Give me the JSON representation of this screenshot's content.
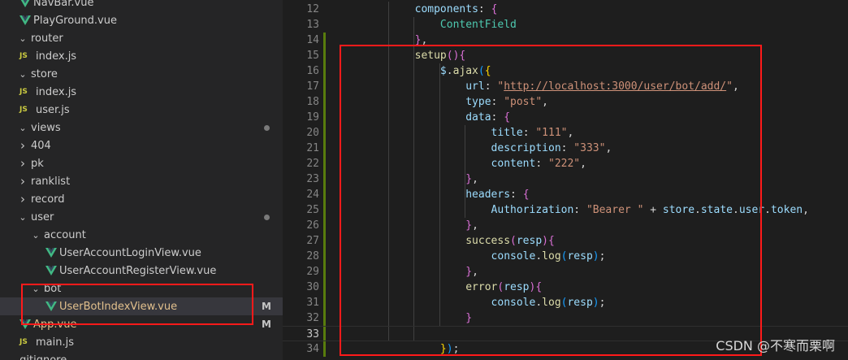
{
  "explorer": {
    "items": [
      {
        "label": "NavBar.vue",
        "type": "vue",
        "indent": 2
      },
      {
        "label": "PlayGround.vue",
        "type": "vue",
        "indent": 2
      },
      {
        "label": "router",
        "type": "folder-open",
        "indent": 1
      },
      {
        "label": "index.js",
        "type": "js",
        "indent": 2
      },
      {
        "label": "store",
        "type": "folder-open",
        "indent": 1
      },
      {
        "label": "index.js",
        "type": "js",
        "indent": 2
      },
      {
        "label": "user.js",
        "type": "js",
        "indent": 2
      },
      {
        "label": "views",
        "type": "folder-open",
        "indent": 1,
        "dot": true
      },
      {
        "label": "404",
        "type": "folder-closed",
        "indent": 2
      },
      {
        "label": "pk",
        "type": "folder-closed",
        "indent": 2
      },
      {
        "label": "ranklist",
        "type": "folder-closed",
        "indent": 2
      },
      {
        "label": "record",
        "type": "folder-closed",
        "indent": 2
      },
      {
        "label": "user",
        "type": "folder-open",
        "indent": 2,
        "dot": true
      },
      {
        "label": "account",
        "type": "folder-open",
        "indent": 3
      },
      {
        "label": "UserAccountLoginView.vue",
        "type": "vue",
        "indent": 4
      },
      {
        "label": "UserAccountRegisterView.vue",
        "type": "vue",
        "indent": 4
      },
      {
        "label": "bot",
        "type": "folder-open",
        "indent": 3
      },
      {
        "label": "UserBotIndexView.vue",
        "type": "vue",
        "indent": 4,
        "badge": "M",
        "selected": true,
        "modified": true
      },
      {
        "label": "App.vue",
        "type": "vue",
        "indent": 1,
        "badge": "M",
        "modified": true
      },
      {
        "label": "main.js",
        "type": "js",
        "indent": 1
      },
      {
        "label": ".gitignore",
        "type": "file",
        "indent": 0
      }
    ]
  },
  "editor": {
    "active_line": 33,
    "lines": [
      {
        "n": 12,
        "indent": 2,
        "tokens": [
          [
            "prop",
            "components"
          ],
          [
            "plain",
            ": "
          ],
          [
            "brace",
            "{"
          ]
        ]
      },
      {
        "n": 13,
        "indent": 3,
        "tokens": [
          [
            "cls",
            "ContentField"
          ]
        ]
      },
      {
        "n": 14,
        "indent": 2,
        "tokens": [
          [
            "brace",
            "}"
          ],
          [
            "plain",
            ","
          ]
        ]
      },
      {
        "n": 15,
        "indent": 2,
        "tokens": [
          [
            "fn",
            "setup"
          ],
          [
            "brace",
            "()"
          ],
          [
            "brace",
            "{"
          ]
        ]
      },
      {
        "n": 16,
        "indent": 3,
        "tokens": [
          [
            "prop",
            "$"
          ],
          [
            "plain",
            "."
          ],
          [
            "fn",
            "ajax"
          ],
          [
            "brace2",
            "("
          ],
          [
            "paren",
            "{"
          ]
        ]
      },
      {
        "n": 17,
        "indent": 4,
        "tokens": [
          [
            "prop",
            "url"
          ],
          [
            "plain",
            ": "
          ],
          [
            "str",
            "\""
          ],
          [
            "url",
            "http://localhost:3000/user/bot/add/"
          ],
          [
            "str",
            "\""
          ],
          [
            "plain",
            ","
          ]
        ]
      },
      {
        "n": 18,
        "indent": 4,
        "tokens": [
          [
            "prop",
            "type"
          ],
          [
            "plain",
            ": "
          ],
          [
            "str",
            "\"post\""
          ],
          [
            "plain",
            ","
          ]
        ]
      },
      {
        "n": 19,
        "indent": 4,
        "tokens": [
          [
            "prop",
            "data"
          ],
          [
            "plain",
            ": "
          ],
          [
            "brace",
            "{"
          ]
        ]
      },
      {
        "n": 20,
        "indent": 5,
        "tokens": [
          [
            "prop",
            "title"
          ],
          [
            "plain",
            ": "
          ],
          [
            "str",
            "\"111\""
          ],
          [
            "plain",
            ","
          ]
        ]
      },
      {
        "n": 21,
        "indent": 5,
        "tokens": [
          [
            "prop",
            "description"
          ],
          [
            "plain",
            ": "
          ],
          [
            "str",
            "\"333\""
          ],
          [
            "plain",
            ","
          ]
        ]
      },
      {
        "n": 22,
        "indent": 5,
        "tokens": [
          [
            "prop",
            "content"
          ],
          [
            "plain",
            ": "
          ],
          [
            "str",
            "\"222\""
          ],
          [
            "plain",
            ","
          ]
        ]
      },
      {
        "n": 23,
        "indent": 4,
        "tokens": [
          [
            "brace",
            "}"
          ],
          [
            "plain",
            ","
          ]
        ]
      },
      {
        "n": 24,
        "indent": 4,
        "tokens": [
          [
            "prop",
            "headers"
          ],
          [
            "plain",
            ": "
          ],
          [
            "brace",
            "{"
          ]
        ]
      },
      {
        "n": 25,
        "indent": 5,
        "tokens": [
          [
            "prop",
            "Authorization"
          ],
          [
            "plain",
            ": "
          ],
          [
            "str",
            "\"Bearer \""
          ],
          [
            "plain",
            " + "
          ],
          [
            "prop",
            "store"
          ],
          [
            "plain",
            "."
          ],
          [
            "prop",
            "state"
          ],
          [
            "plain",
            "."
          ],
          [
            "prop",
            "user"
          ],
          [
            "plain",
            "."
          ],
          [
            "prop",
            "token"
          ],
          [
            "plain",
            ","
          ]
        ]
      },
      {
        "n": 26,
        "indent": 4,
        "tokens": [
          [
            "brace",
            "}"
          ],
          [
            "plain",
            ","
          ]
        ]
      },
      {
        "n": 27,
        "indent": 4,
        "tokens": [
          [
            "fn",
            "success"
          ],
          [
            "brace",
            "("
          ],
          [
            "prop",
            "resp"
          ],
          [
            "brace",
            ")"
          ],
          [
            "brace",
            "{"
          ]
        ]
      },
      {
        "n": 28,
        "indent": 5,
        "tokens": [
          [
            "prop",
            "console"
          ],
          [
            "plain",
            "."
          ],
          [
            "fn",
            "log"
          ],
          [
            "brace2",
            "("
          ],
          [
            "prop",
            "resp"
          ],
          [
            "brace2",
            ")"
          ],
          [
            "plain",
            ";"
          ]
        ]
      },
      {
        "n": 29,
        "indent": 4,
        "tokens": [
          [
            "brace",
            "}"
          ],
          [
            "plain",
            ","
          ]
        ]
      },
      {
        "n": 30,
        "indent": 4,
        "tokens": [
          [
            "fn",
            "error"
          ],
          [
            "brace",
            "("
          ],
          [
            "prop",
            "resp"
          ],
          [
            "brace",
            ")"
          ],
          [
            "brace",
            "{"
          ]
        ]
      },
      {
        "n": 31,
        "indent": 5,
        "tokens": [
          [
            "prop",
            "console"
          ],
          [
            "plain",
            "."
          ],
          [
            "fn",
            "log"
          ],
          [
            "brace2",
            "("
          ],
          [
            "prop",
            "resp"
          ],
          [
            "brace2",
            ")"
          ],
          [
            "plain",
            ";"
          ]
        ]
      },
      {
        "n": 32,
        "indent": 4,
        "tokens": [
          [
            "brace",
            "}"
          ]
        ]
      },
      {
        "n": 33,
        "indent": 0,
        "tokens": []
      },
      {
        "n": 34,
        "indent": 3,
        "tokens": [
          [
            "paren",
            "}"
          ],
          [
            "brace2",
            ")"
          ],
          [
            "plain",
            ";"
          ]
        ]
      }
    ]
  },
  "watermark": "CSDN @不寒而栗啊",
  "colors": {
    "annotation": "#ff1a1a",
    "git_added": "#587c0c",
    "vue_green": "#41b883",
    "js_yellow": "#cbcb41"
  },
  "icons": {
    "folder_open": "chevron-down-icon",
    "folder_closed": "chevron-right-icon",
    "vue": "vue-logo-icon",
    "js": "js-file-icon"
  }
}
